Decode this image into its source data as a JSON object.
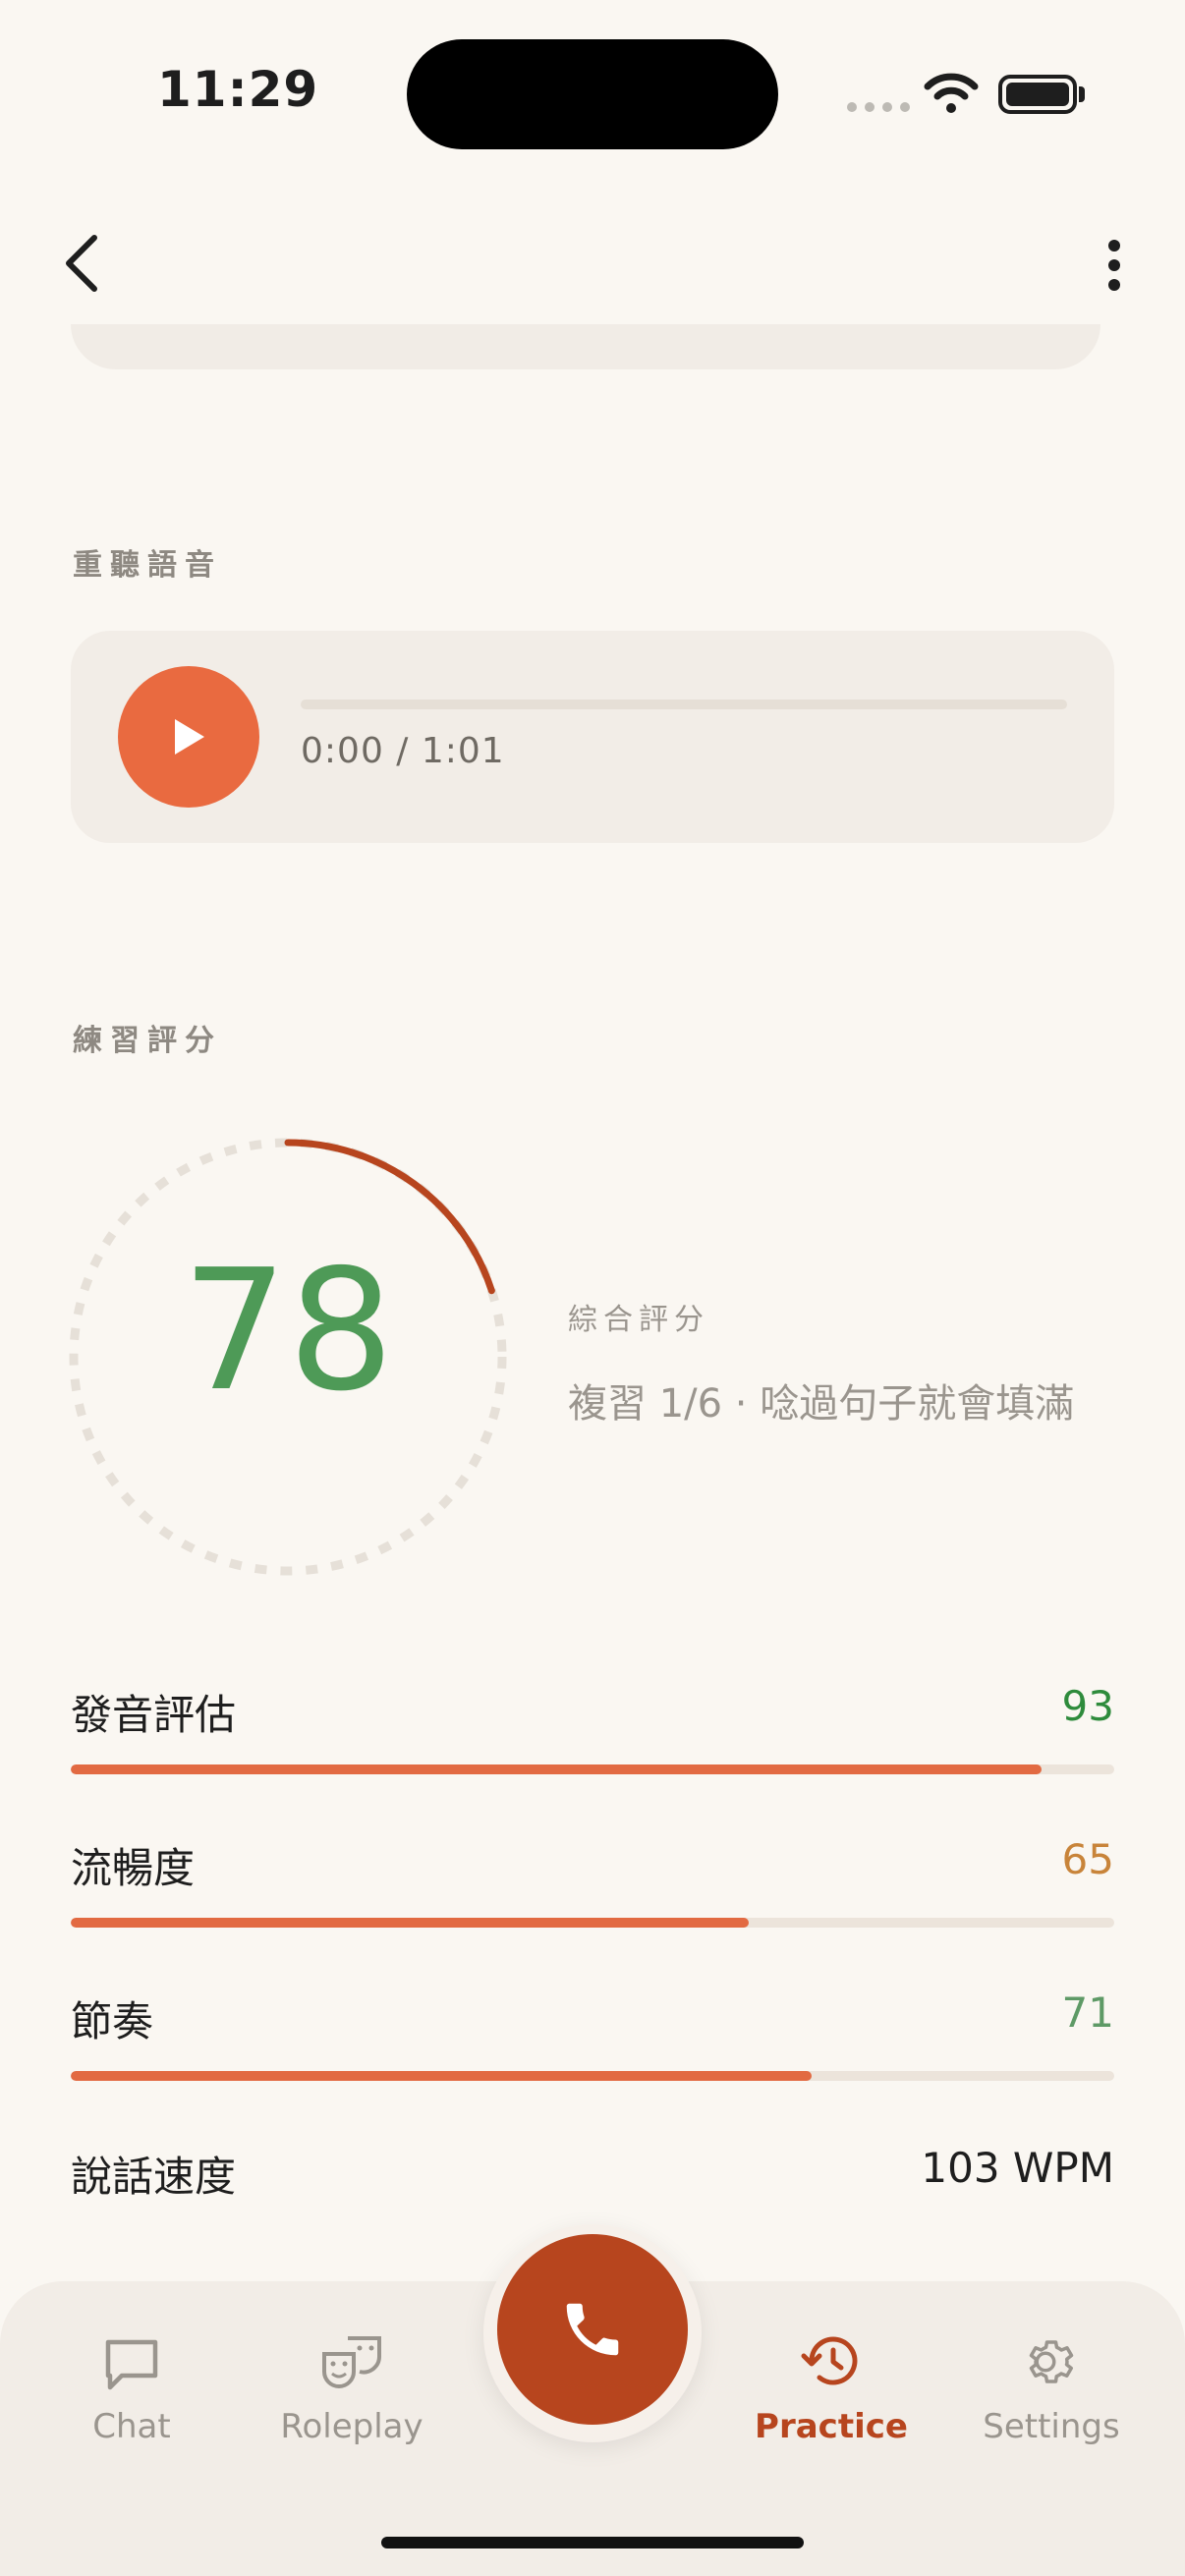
{
  "status": {
    "time": "11:29"
  },
  "replay": {
    "section_label": "重聽語音",
    "time_display": "0:00 / 1:01",
    "progress": 0
  },
  "score": {
    "section_label": "練習評分",
    "value": "78",
    "ring_progress": 0.2,
    "overall_label": "綜合評分",
    "subtitle": "複習 1/6 · 唸過句子就會填滿"
  },
  "metrics": [
    {
      "label": "發音評估",
      "value": "93",
      "fraction": 0.93,
      "color": "#2E8B3C"
    },
    {
      "label": "流暢度",
      "value": "65",
      "fraction": 0.65,
      "color": "#C8843A"
    },
    {
      "label": "節奏",
      "value": "71",
      "fraction": 0.71,
      "color": "#5E9A66"
    }
  ],
  "speed": {
    "label": "說話速度",
    "value": "103 WPM"
  },
  "tabs": [
    {
      "label": "Chat",
      "icon": "chat-icon"
    },
    {
      "label": "Roleplay",
      "icon": "masks-icon"
    },
    {
      "label": "Practice",
      "icon": "history-icon",
      "active": true
    },
    {
      "label": "Settings",
      "icon": "gear-icon"
    }
  ],
  "colors": {
    "accent": "#B7451E",
    "play": "#E96A40",
    "bar": "#E26A42",
    "score": "#4E9A57"
  }
}
